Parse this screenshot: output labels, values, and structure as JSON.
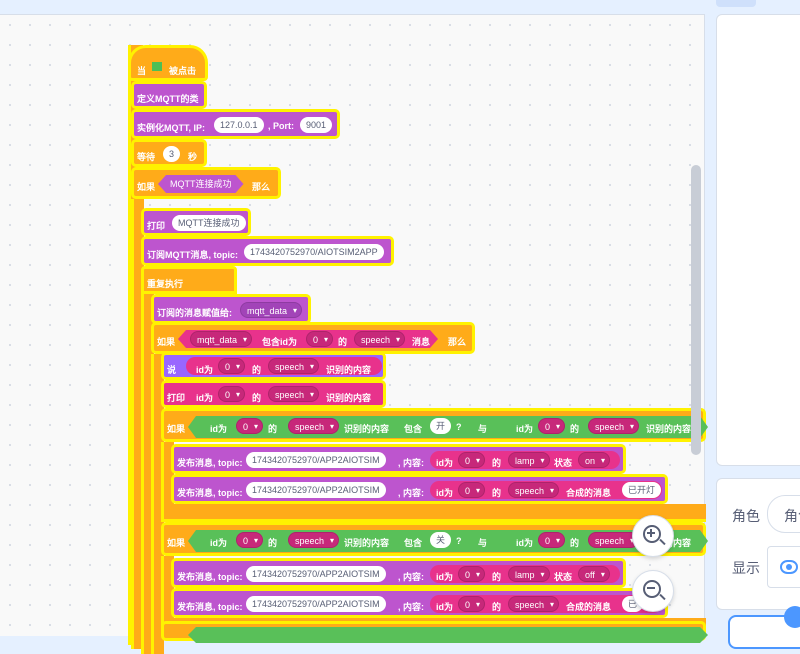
{
  "blocks": {
    "hat": {
      "when": "当",
      "clicked": "被点击"
    },
    "define_class": "定义MQTT的类",
    "instantiate": {
      "label": "实例化MQTT, IP:",
      "ip": "127.0.0.1",
      "port_label": ", Port:",
      "port": "9001"
    },
    "wait": {
      "label": "等待",
      "value": "3",
      "unit": "秒"
    },
    "if1": {
      "if": "如果",
      "cond": "MQTT连接成功",
      "then": "那么"
    },
    "print1": {
      "label": "打印",
      "value": "MQTT连接成功"
    },
    "subscribe": {
      "label": "订阅MQTT消息, topic:",
      "topic": "1743420752970/AIOTSIM2APP"
    },
    "forever": "重复执行",
    "assign": {
      "label": "订阅的消息赋值给:",
      "var": "mqtt_data"
    },
    "if2": {
      "if": "如果",
      "var": "mqtt_data",
      "contains_id": "包含id为",
      "id": "0",
      "of": "的",
      "device": "speech",
      "msg": "消息",
      "then": "那么"
    },
    "say": {
      "label": "说",
      "id_label": "id为",
      "id": "0",
      "of": "的",
      "device": "speech",
      "content": "识别的内容"
    },
    "print2": {
      "label": "打印",
      "id_label": "id为",
      "id": "0",
      "of": "的",
      "device": "speech",
      "content": "识别的内容"
    },
    "if3": {
      "if": "如果",
      "id_label": "id为",
      "id": "0",
      "of": "的",
      "device": "speech",
      "content": "识别的内容",
      "contains": "包含",
      "word": "开",
      "q": "?",
      "and": "与"
    },
    "if3_right": {
      "id_label": "id为",
      "id": "0",
      "of": "的",
      "device": "speech",
      "content": "识别的内容"
    },
    "pub1": {
      "label": "发布消息, topic:",
      "topic": "1743420752970/APP2AIOTSIM",
      "content_label": ", 内容:",
      "id_label": "id为",
      "id": "0",
      "of": "的",
      "device": "lamp",
      "state_label": "状态",
      "state": "on"
    },
    "pub2": {
      "label": "发布消息, topic:",
      "topic": "1743420752970/APP2AIOTSIM",
      "content_label": ", 内容:",
      "id_label": "id为",
      "id": "0",
      "of": "的",
      "device": "speech",
      "synth": "合成的消息",
      "text": "已开灯"
    },
    "if4": {
      "if": "如果",
      "id_label": "id为",
      "id": "0",
      "of": "的",
      "device": "speech",
      "content": "识别的内容",
      "contains": "包含",
      "word": "关",
      "q": "?",
      "and": "与"
    },
    "if4_right": {
      "id_label": "id为",
      "id": "0",
      "of": "的",
      "device": "speech",
      "content": "识别的内容"
    },
    "pub3": {
      "label": "发布消息, topic:",
      "topic": "1743420752970/APP2AIOTSIM",
      "content_label": ", 内容:",
      "id_label": "id为",
      "id": "0",
      "of": "的",
      "device": "lamp",
      "state_label": "状态",
      "state": "off"
    },
    "pub4": {
      "label": "发布消息, topic:",
      "topic": "1743420752970/APP2AIOTSIM",
      "content_label": ", 内容:",
      "id_label": "id为",
      "id": "0",
      "of": "的",
      "device": "speech",
      "synth": "合成的消息",
      "text": "已"
    }
  },
  "sprite_panel": {
    "sprite_label": "角色",
    "sprite_value": "角色",
    "show_label": "显示"
  },
  "icons": {
    "zoom_in": "zoom-in-icon",
    "zoom_out": "zoom-out-icon",
    "flag": "green-flag-icon",
    "eye": "eye-icon"
  },
  "colors": {
    "control": "#ffab19",
    "mqtt": "#bd55ce",
    "operator": "#59c059",
    "data": "#e8328c",
    "looks": "#9966ff",
    "highlight": "#fff200"
  }
}
